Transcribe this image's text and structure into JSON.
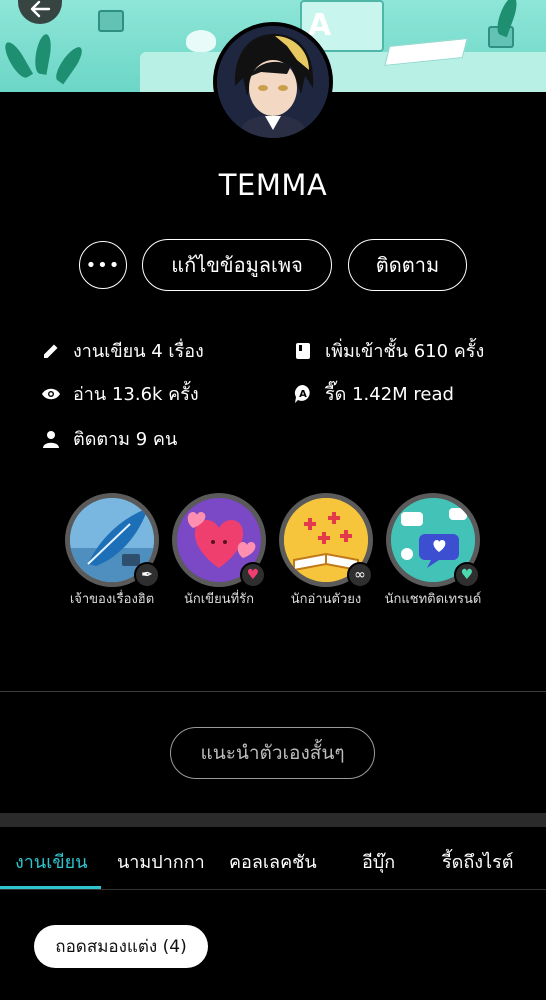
{
  "profile": {
    "name": "TEMMA"
  },
  "actions": {
    "more_label": "•••",
    "edit_label": "แก้ไขข้อมูลเพจ",
    "follow_label": "ติดตาม"
  },
  "stats": {
    "works": "งานเขียน 4 เรื่อง",
    "shelf": "เพิ่มเข้าชั้น 610 ครั้ง",
    "reads": "อ่าน 13.6k ครั้ง",
    "reader_reads": "รี๊ด 1.42M read",
    "followers": "ติดตาม 9 คน"
  },
  "badges": [
    {
      "label": "เจ้าของเรื่องฮิต",
      "icon": "feather-icon"
    },
    {
      "label": "นักเขียนที่รัก",
      "icon": "heart-icon"
    },
    {
      "label": "นักอ่านตัวยง",
      "icon": "book-icon"
    },
    {
      "label": "นักแชทติดเทรนด์",
      "icon": "chat-icon"
    }
  ],
  "intro_button": "แนะนำตัวเองสั้นๆ",
  "tabs": [
    {
      "label": "งานเขียน",
      "active": true
    },
    {
      "label": "นามปากกา",
      "active": false
    },
    {
      "label": "คอลเลคชัน",
      "active": false
    },
    {
      "label": "อีบุ๊ก",
      "active": false
    },
    {
      "label": "รี้ดถึงไรต์",
      "active": false
    }
  ],
  "filter_chip": "ถอดสมองแต่ง (4)",
  "colors": {
    "accent": "#2ec5cf",
    "background": "#000000",
    "banner": "#7fe0d2"
  }
}
